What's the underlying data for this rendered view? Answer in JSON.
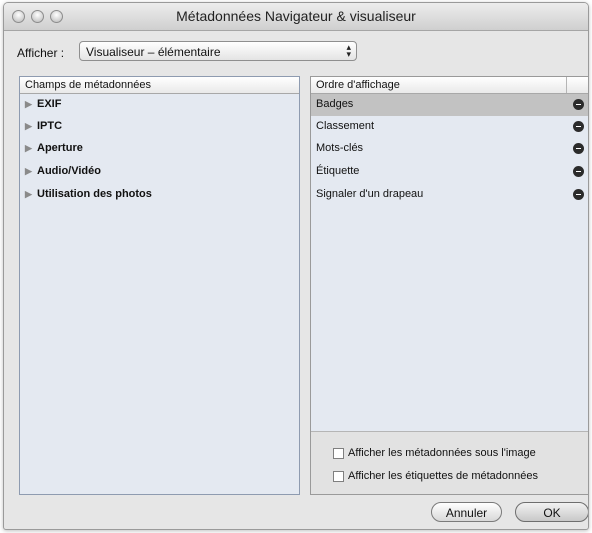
{
  "window": {
    "title": "Métadonnées Navigateur & visualiseur"
  },
  "view": {
    "label": "Afficher :",
    "selected": "Visualiseur – élémentaire"
  },
  "fields_panel": {
    "header": "Champs de métadonnées",
    "items": [
      "EXIF",
      "IPTC",
      "Aperture",
      "Audio/Vidéo",
      "Utilisation des photos"
    ]
  },
  "order_panel": {
    "header": "Ordre d'affichage",
    "items": [
      "Badges",
      "Classement",
      "Mots-clés",
      "Étiquette",
      "Signaler d'un drapeau"
    ],
    "selected_index": 0
  },
  "options": {
    "under_image": "Afficher les métadonnées sous l'image",
    "show_labels": "Afficher les étiquettes de métadonnées"
  },
  "buttons": {
    "cancel": "Annuler",
    "ok": "OK"
  },
  "icons": {
    "close": "close-traffic-light-icon",
    "minimize": "minimize-traffic-light-icon",
    "zoom": "zoom-traffic-light-icon",
    "disclosure": "disclosure-triangle-icon",
    "remove": "remove-minus-icon",
    "popup": "popup-arrows-icon"
  },
  "colors": {
    "selection": "#c2c2c2",
    "list_background": "#e4e9f1",
    "window": "#e6e6e6"
  }
}
